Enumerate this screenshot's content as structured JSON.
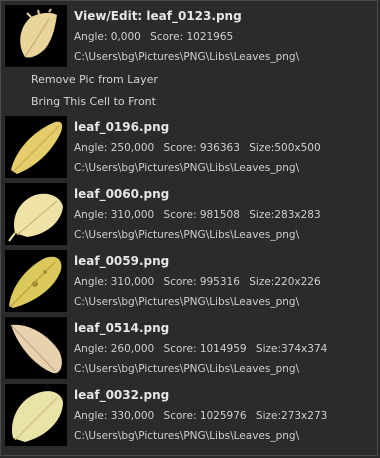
{
  "header": {
    "title": "View/Edit: leaf_0123.png",
    "angle": "Angle: 0,000",
    "score": "Score: 1021965",
    "path": "C:\\Users\\bg\\Pictures\\PNG\\Libs\\Leaves_png\\"
  },
  "commands": {
    "remove": "Remove Pic from Layer",
    "bring_front": "Bring This Cell to Front"
  },
  "items": [
    {
      "name": "leaf_0196.png",
      "angle": "Angle: 250,000",
      "score": "Score: 936363",
      "size": "Size:500x500",
      "path": "C:\\Users\\bg\\Pictures\\PNG\\Libs\\Leaves_png\\"
    },
    {
      "name": "leaf_0060.png",
      "angle": "Angle: 310,000",
      "score": "Score: 981508",
      "size": "Size:283x283",
      "path": "C:\\Users\\bg\\Pictures\\PNG\\Libs\\Leaves_png\\"
    },
    {
      "name": "leaf_0059.png",
      "angle": "Angle: 310,000",
      "score": "Score: 995316",
      "size": "Size:220x226",
      "path": "C:\\Users\\bg\\Pictures\\PNG\\Libs\\Leaves_png\\"
    },
    {
      "name": "leaf_0514.png",
      "angle": "Angle: 260,000",
      "score": "Score: 1014959",
      "size": "Size:374x374",
      "path": "C:\\Users\\bg\\Pictures\\PNG\\Libs\\Leaves_png\\"
    },
    {
      "name": "leaf_0032.png",
      "angle": "Angle: 330,000",
      "score": "Score: 1025976",
      "size": "Size:273x273",
      "path": "C:\\Users\\bg\\Pictures\\PNG\\Libs\\Leaves_png\\"
    }
  ],
  "colors": {
    "background": "#2b2b2b",
    "text": "#d9d9d9",
    "thumb_bg": "#000000"
  }
}
